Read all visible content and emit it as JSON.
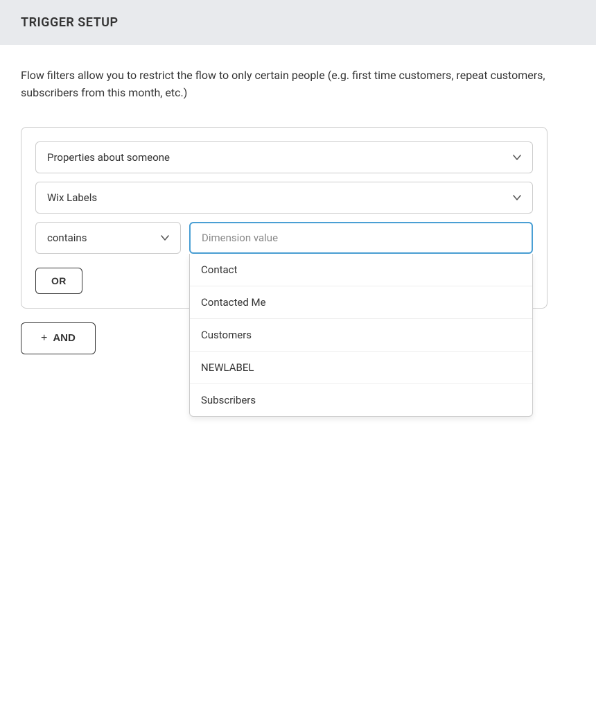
{
  "header": {
    "title": "TRIGGER SETUP",
    "background": "#e8eaed"
  },
  "description": "Flow filters allow you to restrict the flow to only certain people (e.g. first time customers, repeat customers, subscribers from this month, etc.)",
  "filter": {
    "properties_select": {
      "value": "Properties about someone",
      "placeholder": "Properties about someone"
    },
    "labels_select": {
      "value": "Wix Labels",
      "placeholder": "Wix Labels"
    },
    "condition_select": {
      "value": "contains",
      "placeholder": "contains"
    },
    "value_input": {
      "placeholder": "Dimension value"
    },
    "dropdown_items": [
      {
        "label": "Contact"
      },
      {
        "label": "Contacted Me"
      },
      {
        "label": "Customers"
      },
      {
        "label": "NEWLABEL"
      },
      {
        "label": "Subscribers"
      }
    ],
    "or_button_label": "OR",
    "and_button_label": "AND",
    "plus_label": "+"
  }
}
